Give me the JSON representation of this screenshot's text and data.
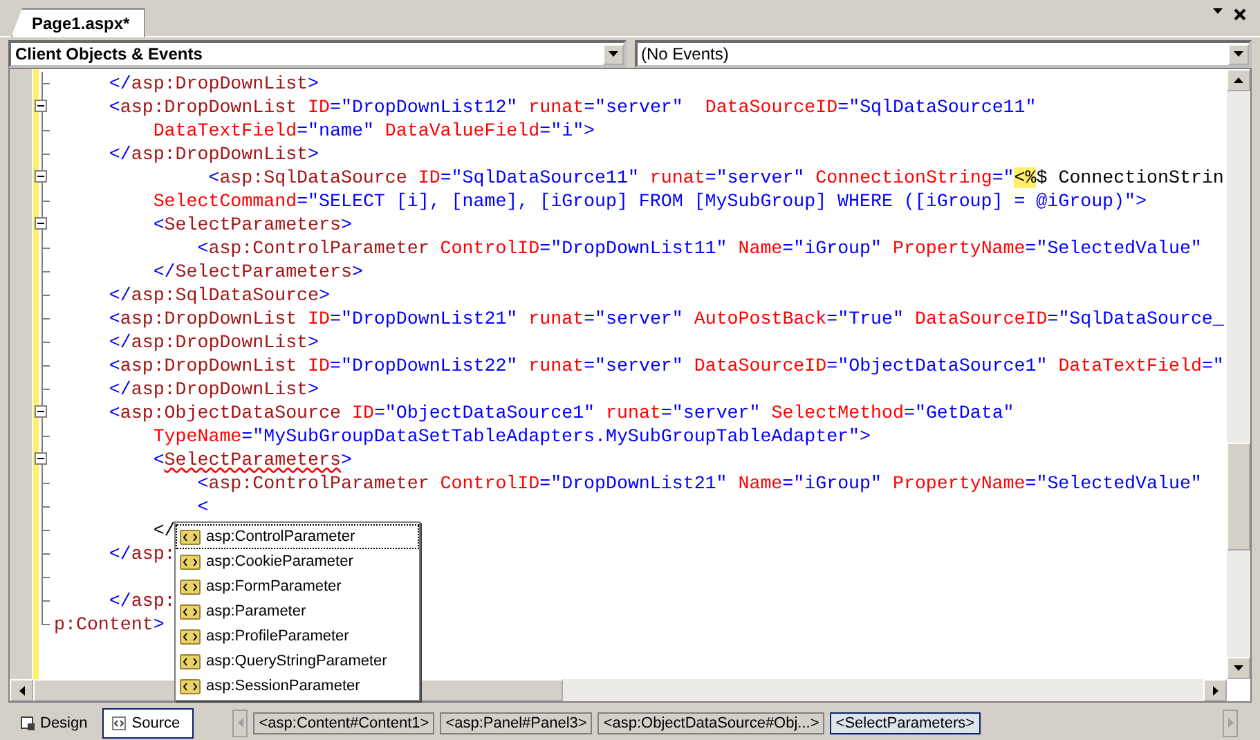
{
  "document_tab": {
    "title": "Page1.aspx*"
  },
  "object_dropdown": {
    "value": "Client Objects & Events"
  },
  "event_dropdown": {
    "value": "(No Events)"
  },
  "code_lines": [
    {
      "foldable": false,
      "segments": [
        {
          "kind": "punct",
          "text": "     </"
        },
        {
          "kind": "element",
          "text": "asp:DropDownList"
        },
        {
          "kind": "punct",
          "text": ">"
        }
      ]
    },
    {
      "foldable": true,
      "segments": [
        {
          "kind": "punct",
          "text": "     <"
        },
        {
          "kind": "element",
          "text": "asp:DropDownList"
        },
        {
          "kind": "attribute",
          "text": " ID"
        },
        {
          "kind": "value",
          "text": "=\"DropDownList12\""
        },
        {
          "kind": "attribute",
          "text": " runat"
        },
        {
          "kind": "value",
          "text": "=\"server\""
        },
        {
          "kind": "attribute",
          "text": "  DataSourceID"
        },
        {
          "kind": "value",
          "text": "=\"SqlDataSource11\""
        }
      ]
    },
    {
      "foldable": false,
      "segments": [
        {
          "kind": "attribute",
          "text": "         DataTextField"
        },
        {
          "kind": "value",
          "text": "=\"name\""
        },
        {
          "kind": "attribute",
          "text": " DataValueField"
        },
        {
          "kind": "value",
          "text": "=\"i\">"
        }
      ]
    },
    {
      "foldable": false,
      "segments": [
        {
          "kind": "punct",
          "text": "     </"
        },
        {
          "kind": "element",
          "text": "asp:DropDownList"
        },
        {
          "kind": "punct",
          "text": ">"
        }
      ]
    },
    {
      "foldable": true,
      "segments": [
        {
          "kind": "punct",
          "text": "              <"
        },
        {
          "kind": "element",
          "text": "asp:SqlDataSource"
        },
        {
          "kind": "attribute",
          "text": " ID"
        },
        {
          "kind": "value",
          "text": "=\"SqlDataSource11\""
        },
        {
          "kind": "attribute",
          "text": " runat"
        },
        {
          "kind": "value",
          "text": "=\"server\""
        },
        {
          "kind": "attribute",
          "text": " ConnectionString"
        },
        {
          "kind": "value",
          "text": "=\""
        },
        {
          "kind": "marker",
          "text": "<%"
        },
        {
          "kind": "plain",
          "text": "$ ConnectionStrin"
        }
      ]
    },
    {
      "foldable": false,
      "segments": [
        {
          "kind": "attribute",
          "text": "         SelectCommand"
        },
        {
          "kind": "value",
          "text": "=\"SELECT [i], [name], [iGroup] FROM [MySubGroup] WHERE ([iGroup] = @iGroup)\">"
        }
      ]
    },
    {
      "foldable": true,
      "segments": [
        {
          "kind": "punct",
          "text": "         <"
        },
        {
          "kind": "element",
          "text": "SelectParameters"
        },
        {
          "kind": "punct",
          "text": ">"
        }
      ]
    },
    {
      "foldable": false,
      "segments": [
        {
          "kind": "punct",
          "text": "             <"
        },
        {
          "kind": "element",
          "text": "asp:ControlParameter"
        },
        {
          "kind": "attribute",
          "text": " ControlID"
        },
        {
          "kind": "value",
          "text": "=\"DropDownList11\""
        },
        {
          "kind": "attribute",
          "text": " Name"
        },
        {
          "kind": "value",
          "text": "=\"iGroup\""
        },
        {
          "kind": "attribute",
          "text": " PropertyName"
        },
        {
          "kind": "value",
          "text": "=\"SelectedValue\""
        }
      ]
    },
    {
      "foldable": false,
      "segments": [
        {
          "kind": "punct",
          "text": "         </"
        },
        {
          "kind": "element",
          "text": "SelectParameters"
        },
        {
          "kind": "punct",
          "text": ">"
        }
      ]
    },
    {
      "foldable": false,
      "segments": [
        {
          "kind": "punct",
          "text": "     </"
        },
        {
          "kind": "element",
          "text": "asp:SqlDataSource"
        },
        {
          "kind": "punct",
          "text": ">"
        }
      ]
    },
    {
      "foldable": false,
      "segments": [
        {
          "kind": "punct",
          "text": "     <"
        },
        {
          "kind": "element",
          "text": "asp:DropDownList"
        },
        {
          "kind": "attribute",
          "text": " ID"
        },
        {
          "kind": "value",
          "text": "=\"DropDownList21\""
        },
        {
          "kind": "attribute",
          "text": " runat"
        },
        {
          "kind": "value",
          "text": "=\"server\""
        },
        {
          "kind": "attribute",
          "text": " AutoPostBack"
        },
        {
          "kind": "value",
          "text": "=\"True\""
        },
        {
          "kind": "attribute",
          "text": " DataSourceID"
        },
        {
          "kind": "value",
          "text": "=\"SqlDataSource_"
        }
      ]
    },
    {
      "foldable": false,
      "segments": [
        {
          "kind": "punct",
          "text": "     </"
        },
        {
          "kind": "element",
          "text": "asp:DropDownList"
        },
        {
          "kind": "punct",
          "text": ">"
        }
      ]
    },
    {
      "foldable": false,
      "segments": [
        {
          "kind": "punct",
          "text": "     <"
        },
        {
          "kind": "element",
          "text": "asp:DropDownList"
        },
        {
          "kind": "attribute",
          "text": " ID"
        },
        {
          "kind": "value",
          "text": "=\"DropDownList22\""
        },
        {
          "kind": "attribute",
          "text": " runat"
        },
        {
          "kind": "value",
          "text": "=\"server\""
        },
        {
          "kind": "attribute",
          "text": " DataSourceID"
        },
        {
          "kind": "value",
          "text": "=\"ObjectDataSource1\""
        },
        {
          "kind": "attribute",
          "text": " DataTextField"
        },
        {
          "kind": "value",
          "text": "=\""
        }
      ]
    },
    {
      "foldable": false,
      "segments": [
        {
          "kind": "punct",
          "text": "     </"
        },
        {
          "kind": "element",
          "text": "asp:DropDownList"
        },
        {
          "kind": "punct",
          "text": ">"
        }
      ]
    },
    {
      "foldable": true,
      "segments": [
        {
          "kind": "punct",
          "text": "     <"
        },
        {
          "kind": "element",
          "text": "asp:ObjectDataSource"
        },
        {
          "kind": "attribute",
          "text": " ID"
        },
        {
          "kind": "value",
          "text": "=\"ObjectDataSource1\""
        },
        {
          "kind": "attribute",
          "text": " runat"
        },
        {
          "kind": "value",
          "text": "=\"server\""
        },
        {
          "kind": "attribute",
          "text": " SelectMethod"
        },
        {
          "kind": "value",
          "text": "=\"GetData\""
        }
      ]
    },
    {
      "foldable": false,
      "segments": [
        {
          "kind": "attribute",
          "text": "         TypeName"
        },
        {
          "kind": "value",
          "text": "=\"MySubGroupDataSetTableAdapters.MySubGroupTableAdapter\">"
        }
      ]
    },
    {
      "foldable": true,
      "segments": [
        {
          "kind": "punct",
          "text": "         <"
        },
        {
          "kind": "squiggle",
          "text": "SelectParameters"
        },
        {
          "kind": "punct",
          "text": ">"
        }
      ]
    },
    {
      "foldable": false,
      "segments": [
        {
          "kind": "punct",
          "text": "             <"
        },
        {
          "kind": "element",
          "text": "asp:ControlParameter"
        },
        {
          "kind": "attribute",
          "text": " ControlID"
        },
        {
          "kind": "value",
          "text": "=\"DropDownList21\""
        },
        {
          "kind": "attribute",
          "text": " Name"
        },
        {
          "kind": "value",
          "text": "=\"iGroup\""
        },
        {
          "kind": "attribute",
          "text": " PropertyName"
        },
        {
          "kind": "value",
          "text": "=\"SelectedValue\""
        }
      ]
    },
    {
      "foldable": false,
      "segments": [
        {
          "kind": "punct",
          "text": "             <"
        }
      ]
    },
    {
      "foldable": false,
      "segments": [
        {
          "kind": "plain",
          "text": "         </"
        }
      ]
    },
    {
      "foldable": false,
      "segments": [
        {
          "kind": "punct",
          "text": "     </"
        },
        {
          "kind": "element",
          "text": "asp:"
        }
      ]
    },
    {
      "foldable": false
    },
    {
      "foldable": false,
      "segments": [
        {
          "kind": "punct",
          "text": "     </"
        },
        {
          "kind": "element",
          "text": "asp:"
        }
      ]
    },
    {
      "foldable": false,
      "segments": [
        {
          "kind": "element",
          "text": "p:Content"
        },
        {
          "kind": "punct",
          "text": ">"
        }
      ]
    }
  ],
  "completion_list": [
    {
      "label": "asp:ControlParameter",
      "selected": true
    },
    {
      "label": "asp:CookieParameter",
      "selected": false
    },
    {
      "label": "asp:FormParameter",
      "selected": false
    },
    {
      "label": "asp:Parameter",
      "selected": false
    },
    {
      "label": "asp:ProfileParameter",
      "selected": false
    },
    {
      "label": "asp:QueryStringParameter",
      "selected": false
    },
    {
      "label": "asp:SessionParameter",
      "selected": false
    }
  ],
  "view_tabs": [
    {
      "label": "Design",
      "selected": false
    },
    {
      "label": "Source",
      "selected": true
    }
  ],
  "breadcrumbs": [
    {
      "label": "<asp:Content#Content1>",
      "selected": false
    },
    {
      "label": "<asp:Panel#Panel3>",
      "selected": false
    },
    {
      "label": "<asp:ObjectDataSource#Obj...>",
      "selected": false
    },
    {
      "label": "<SelectParameters>",
      "selected": true
    }
  ]
}
